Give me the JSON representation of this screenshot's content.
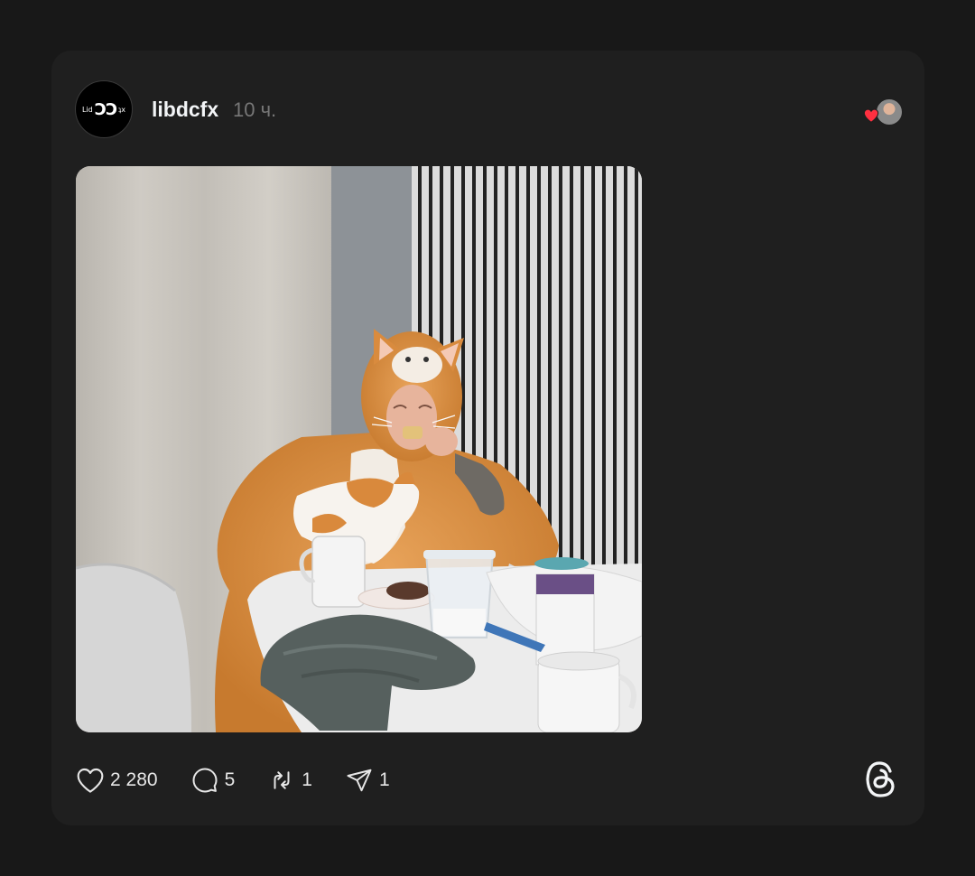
{
  "post": {
    "author": {
      "username": "libdcfx",
      "avatar_text_small": "Lid",
      "avatar_text_large": "ƆƆ",
      "avatar_text_small2": "ʇx"
    },
    "timestamp": "10 ч.",
    "liked_by_indicator": {
      "icon": "heart-icon",
      "heart_color": "#ff3040"
    },
    "media": {
      "icon": "photo"
    },
    "actions": [
      {
        "name": "like",
        "icon": "heart-outline-icon",
        "count": "2 280"
      },
      {
        "name": "comment",
        "icon": "comment-icon",
        "count": "5"
      },
      {
        "name": "repost",
        "icon": "repost-icon",
        "count": "1"
      },
      {
        "name": "share",
        "icon": "send-icon",
        "count": "1"
      }
    ],
    "brand_icon": "threads-logo-icon"
  },
  "colors": {
    "page_background": "#181818",
    "card_background": "#1f1f1f",
    "text_primary": "#f3f5f7",
    "text_secondary": "#777777"
  }
}
